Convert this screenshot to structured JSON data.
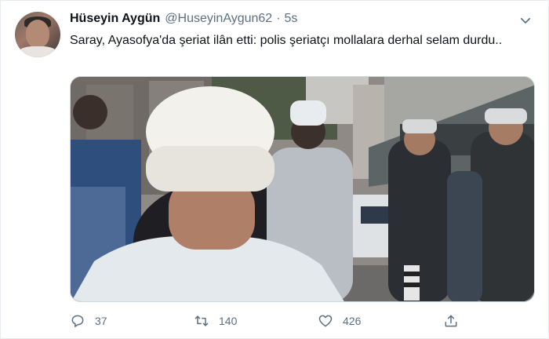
{
  "tweet": {
    "author_name": "Hüseyin Aygün",
    "handle": "@HuseyinAygun62",
    "separator": "·",
    "time": "5s",
    "text": "Saray, Ayasofya'da şeriat ilân etti: polis şeriatçı mollalara derhal selam durdu.."
  },
  "actions": {
    "reply_count": "37",
    "retweet_count": "140",
    "like_count": "426"
  },
  "icons": {
    "more": "chevron-down-icon",
    "reply": "reply-icon",
    "retweet": "retweet-icon",
    "like": "heart-icon",
    "share": "share-icon"
  },
  "colors": {
    "secondary_text": "#5b7083",
    "primary_text": "#0f1419",
    "border": "#e6ecf0"
  }
}
